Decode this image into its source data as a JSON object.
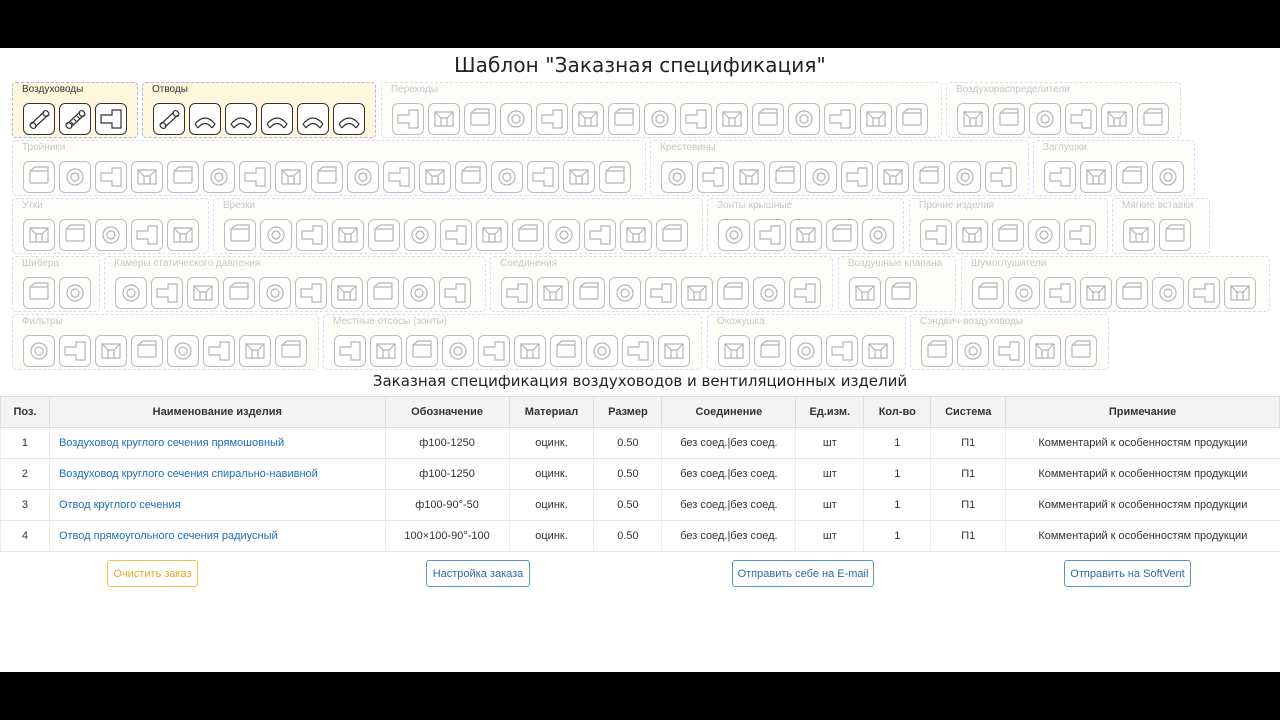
{
  "page_title": "Шаблон \"Заказная спецификация\"",
  "table_title": "Заказная спецификация воздуховодов и вентиляционных изделий",
  "groups": [
    {
      "label": "Воздуховоды",
      "active": true,
      "icons": [
        "round-straight-duct-icon",
        "spiral-duct-icon",
        "rect-duct-icon"
      ]
    },
    {
      "label": "Отводы",
      "active": true,
      "icons": [
        "round-bend-icon",
        "segment-bend-icon",
        "rect-bend-icon",
        "rect-bend-icon",
        "rect-radius-bend-icon",
        "rect-bend-icon"
      ]
    },
    {
      "label": "Переходы",
      "active": false,
      "icons": [
        "transition-icon",
        "transition-icon",
        "transition-icon",
        "transition-icon",
        "transition-icon",
        "transition-icon",
        "transition-icon",
        "transition-icon",
        "transition-icon",
        "transition-icon",
        "transition-icon",
        "transition-icon",
        "transition-icon",
        "transition-icon",
        "transition-icon"
      ]
    },
    {
      "label": "Воздухораспределители",
      "active": false,
      "icons": [
        "diffuser-icon",
        "grille-icon",
        "nozzle-icon",
        "nozzle-icon",
        "valve-icon",
        "nozzle-icon"
      ]
    },
    {
      "label": "Тройники",
      "active": false,
      "icons": [
        "tee-icon",
        "tee-icon",
        "tee-icon",
        "tee-icon",
        "tee-icon",
        "tee-icon",
        "tee-icon",
        "tee-icon",
        "tee-icon",
        "tee-icon",
        "tee-icon",
        "tee-icon",
        "tee-icon",
        "tee-icon",
        "tee-icon",
        "tee-icon",
        "tee-icon"
      ]
    },
    {
      "label": "Крестовины",
      "active": false,
      "icons": [
        "cross-icon",
        "cross-icon",
        "cross-icon",
        "cross-icon",
        "cross-icon",
        "cross-icon",
        "cross-icon",
        "cross-icon",
        "cross-icon",
        "cross-icon"
      ]
    },
    {
      "label": "Заглушки",
      "active": false,
      "icons": [
        "cap-icon",
        "cap-icon",
        "cap-icon",
        "cap-icon"
      ]
    },
    {
      "label": "Утки",
      "active": false,
      "icons": [
        "offset-icon",
        "offset-icon",
        "offset-icon",
        "offset-icon",
        "offset-icon"
      ]
    },
    {
      "label": "Врезки",
      "active": false,
      "icons": [
        "tap-icon",
        "tap-icon",
        "tap-icon",
        "tap-icon",
        "tap-icon",
        "tap-icon",
        "tap-icon",
        "tap-icon",
        "tap-icon",
        "tap-icon",
        "tap-icon",
        "tap-icon",
        "tap-icon"
      ]
    },
    {
      "label": "Зонты крышные",
      "active": false,
      "icons": [
        "roof-cap-icon",
        "roof-cap-icon",
        "roof-cap-icon",
        "roof-cap-icon",
        "roof-cap-icon"
      ]
    },
    {
      "label": "Прочие изделия",
      "active": false,
      "icons": [
        "misc-icon",
        "misc-icon",
        "misc-icon",
        "misc-icon",
        "misc-icon"
      ]
    },
    {
      "label": "Мягкие вставки",
      "active": false,
      "icons": [
        "flex-connector-icon",
        "flex-connector-icon"
      ]
    },
    {
      "label": "Шибера",
      "active": false,
      "icons": [
        "damper-icon",
        "damper-icon"
      ]
    },
    {
      "label": "Камеры статического давления",
      "active": false,
      "icons": [
        "plenum-icon",
        "plenum-icon",
        "plenum-icon",
        "plenum-icon",
        "plenum-icon",
        "plenum-icon",
        "plenum-icon",
        "plenum-icon",
        "plenum-icon",
        "plenum-icon"
      ]
    },
    {
      "label": "Соединения",
      "active": false,
      "icons": [
        "connector-icon",
        "connector-icon",
        "connector-icon",
        "connector-icon",
        "connector-icon",
        "connector-icon",
        "connector-icon",
        "connector-icon",
        "connector-icon"
      ]
    },
    {
      "label": "Воздушные клапана",
      "active": false,
      "icons": [
        "air-valve-icon",
        "air-valve-icon"
      ]
    },
    {
      "label": "Шумоглушители",
      "active": false,
      "icons": [
        "silencer-icon",
        "silencer-icon",
        "silencer-icon",
        "silencer-icon",
        "silencer-icon",
        "silencer-icon",
        "silencer-icon",
        "silencer-icon"
      ]
    },
    {
      "label": "Фильтры",
      "active": false,
      "icons": [
        "filter-icon",
        "filter-icon",
        "filter-icon",
        "filter-icon",
        "filter-icon",
        "filter-icon",
        "filter-icon",
        "filter-icon"
      ]
    },
    {
      "label": "Местные отсосы (зонты)",
      "active": false,
      "icons": [
        "hood-icon",
        "hood-icon",
        "hood-icon",
        "hood-icon",
        "hood-icon",
        "hood-icon",
        "hood-icon",
        "hood-icon",
        "hood-icon",
        "hood-icon"
      ]
    },
    {
      "label": "Окожушка",
      "active": false,
      "icons": [
        "casing-icon",
        "casing-icon",
        "casing-icon",
        "casing-icon",
        "casing-icon"
      ]
    },
    {
      "label": "Сэндвич-воздуховоды",
      "active": false,
      "icons": [
        "sandwich-duct-icon",
        "sandwich-duct-icon",
        "sandwich-duct-icon",
        "sandwich-duct-icon",
        "sandwich-duct-icon"
      ]
    }
  ],
  "table": {
    "headers": [
      "Поз.",
      "Наименование изделия",
      "Обозначение",
      "Материал",
      "Размер",
      "Соединение",
      "Ед.изм.",
      "Кол-во",
      "Система",
      "Примечание"
    ],
    "rows": [
      [
        "1",
        "Воздуховод круглого сечения прямошовный",
        "ф100-1250",
        "оцинк.",
        "0.50",
        "без соед.|без соед.",
        "шт",
        "1",
        "П1",
        "Комментарий к особенностям продукции"
      ],
      [
        "2",
        "Воздуховод круглого сечения спирально-навивной",
        "ф100-1250",
        "оцинк.",
        "0.50",
        "без соед.|без соед.",
        "шт",
        "1",
        "П1",
        "Комментарий к особенностям продукции"
      ],
      [
        "3",
        "Отвод круглого сечения",
        "ф100-90°-50",
        "оцинк.",
        "0.50",
        "без соед.|без соед.",
        "шт",
        "1",
        "П1",
        "Комментарий к особенностям продукции"
      ],
      [
        "4",
        "Отвод прямоугольного сечения радиусный",
        "100×100-90°-100",
        "оцинк.",
        "0.50",
        "без соед.|без соед.",
        "шт",
        "1",
        "П1",
        "Комментарий к особенностям продукции"
      ]
    ]
  },
  "buttons": {
    "clear": "Очистить заказ",
    "settings": "Настройка заказа",
    "email": "Отправить себе на E-mail",
    "send": "Отправить на SoftVent"
  }
}
